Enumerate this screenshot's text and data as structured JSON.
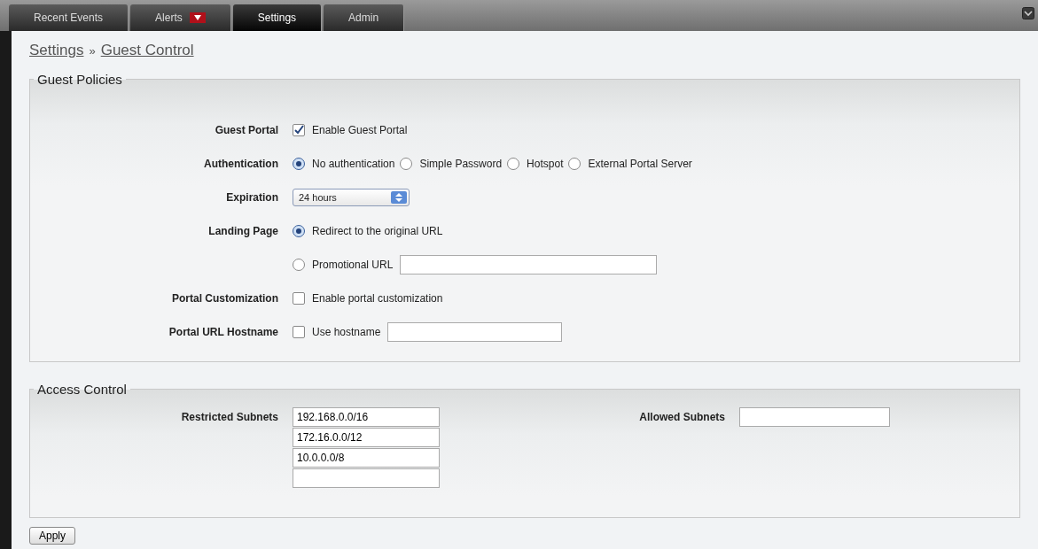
{
  "tabs": [
    {
      "label": "Recent Events",
      "selected": false,
      "badge": false
    },
    {
      "label": "Alerts",
      "selected": false,
      "badge": true
    },
    {
      "label": "Settings",
      "selected": true,
      "badge": false
    },
    {
      "label": "Admin",
      "selected": false,
      "badge": false
    }
  ],
  "breadcrumb": {
    "items": [
      "Settings",
      "Guest Control"
    ],
    "separator": "»"
  },
  "guest_policies": {
    "legend": "Guest Policies",
    "rows": [
      {
        "kind": "checkbox",
        "label": "Guest Portal",
        "options": [
          {
            "label": "Enable Guest Portal",
            "checked": true,
            "field": false
          }
        ]
      },
      {
        "kind": "radio",
        "label": "Authentication",
        "options": [
          {
            "label": "No authentication",
            "selected": true,
            "field": false
          },
          {
            "label": "Simple Password",
            "selected": false,
            "field": false
          },
          {
            "label": "Hotspot",
            "selected": false,
            "field": false
          },
          {
            "label": "External Portal Server",
            "selected": false,
            "field": false
          }
        ]
      },
      {
        "kind": "select",
        "label": "Expiration",
        "value": "24 hours"
      },
      {
        "kind": "radio",
        "label": "Landing Page",
        "options": [
          {
            "label": "Redirect to the original URL",
            "selected": true,
            "field": false
          }
        ]
      },
      {
        "kind": "radio",
        "options": [
          {
            "label": "Promotional URL",
            "selected": false,
            "field": true
          }
        ]
      },
      {
        "kind": "checkbox",
        "label": "Portal Customization",
        "options": [
          {
            "label": "Enable portal customization",
            "checked": false,
            "field": false
          }
        ]
      },
      {
        "kind": "checkbox",
        "label": "Portal URL Hostname",
        "options": [
          {
            "label": "Use hostname",
            "checked": false,
            "field": true
          }
        ]
      }
    ]
  },
  "access_control": {
    "legend": "Access Control",
    "restricted": {
      "label": "Restricted Subnets",
      "values": [
        "192.168.0.0/16",
        "172.16.0.0/12",
        "10.0.0.0/8"
      ]
    },
    "allowed": {
      "label": "Allowed Subnets"
    }
  },
  "apply": "Apply"
}
